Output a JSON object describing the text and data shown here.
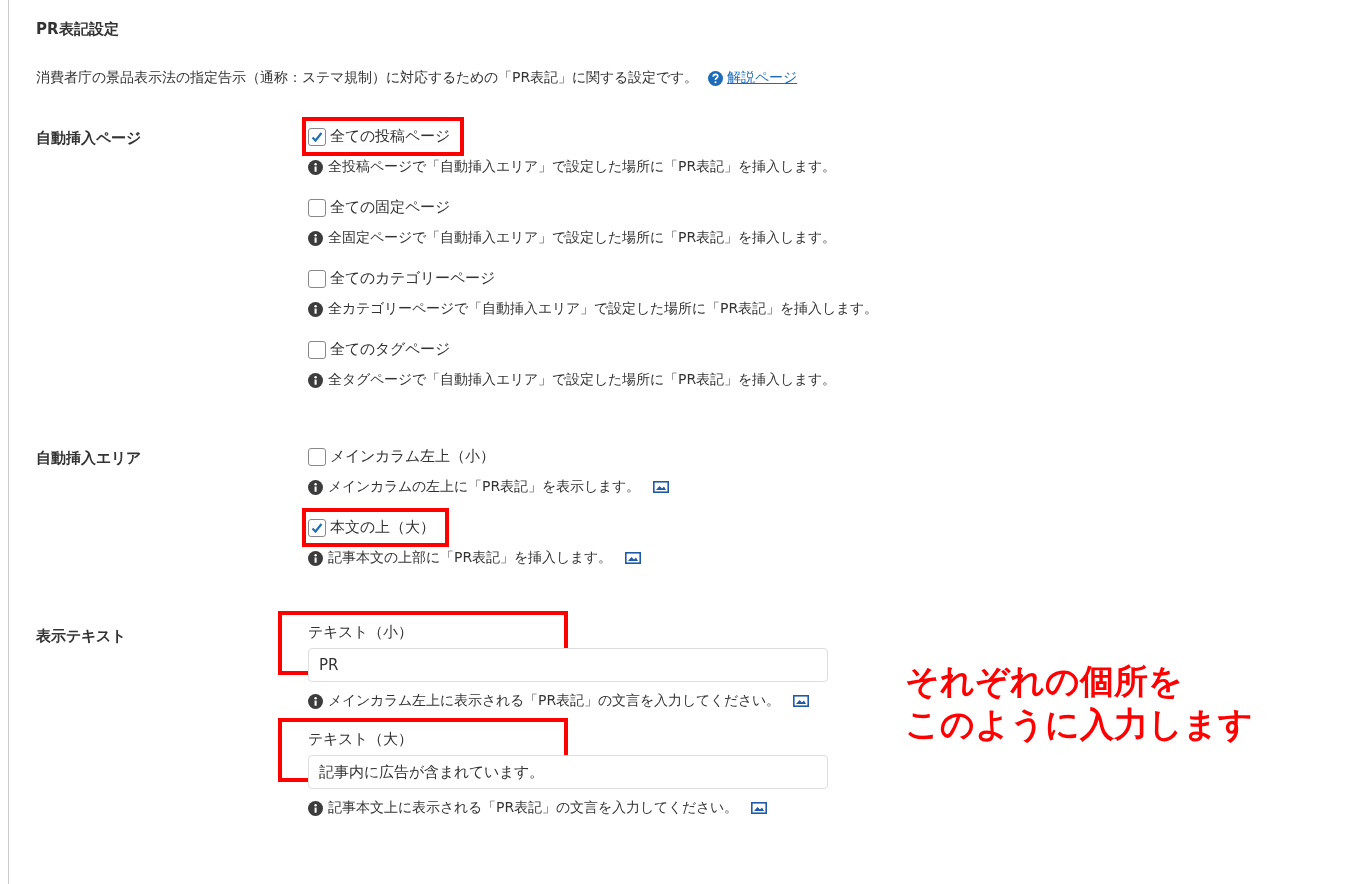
{
  "section_title": "PR表記設定",
  "description": {
    "text": "消費者庁の景品表示法の指定告示（通称：ステマ規制）に対応するための「PR表記」に関する設定です。",
    "link": "解説ページ"
  },
  "rows": [
    {
      "label": "自動挿入ページ",
      "kind": "checkboxes",
      "items": [
        {
          "label": "全ての投稿ページ",
          "checked": true,
          "highlighted": true,
          "help": "全投稿ページで「自動挿入エリア」で設定した場所に「PR表記」を挿入します。",
          "has_image_icon": false
        },
        {
          "label": "全ての固定ページ",
          "checked": false,
          "highlighted": false,
          "help": "全固定ページで「自動挿入エリア」で設定した場所に「PR表記」を挿入します。",
          "has_image_icon": false
        },
        {
          "label": "全てのカテゴリーページ",
          "checked": false,
          "highlighted": false,
          "help": "全カテゴリーページで「自動挿入エリア」で設定した場所に「PR表記」を挿入します。",
          "has_image_icon": false
        },
        {
          "label": "全てのタグページ",
          "checked": false,
          "highlighted": false,
          "help": "全タグページで「自動挿入エリア」で設定した場所に「PR表記」を挿入します。",
          "has_image_icon": false
        }
      ]
    },
    {
      "label": "自動挿入エリア",
      "kind": "checkboxes",
      "items": [
        {
          "label": "メインカラム左上（小）",
          "checked": false,
          "highlighted": false,
          "help": "メインカラムの左上に「PR表記」を表示します。",
          "has_image_icon": true
        },
        {
          "label": "本文の上（大）",
          "checked": true,
          "highlighted": true,
          "help": "記事本文の上部に「PR表記」を挿入します。",
          "has_image_icon": true
        }
      ]
    },
    {
      "label": "表示テキスト",
      "kind": "fields",
      "items": [
        {
          "label": "テキスト（小）",
          "value": "PR",
          "highlighted": true,
          "help": "メインカラム左上に表示される「PR表記」の文言を入力してください。",
          "has_image_icon": true
        },
        {
          "label": "テキスト（大）",
          "value": "記事内に広告が含まれています。",
          "highlighted": true,
          "help": "記事本文上に表示される「PR表記」の文言を入力してください。",
          "has_image_icon": true
        }
      ]
    }
  ],
  "annotation": [
    "それぞれの個所を",
    "このように入力します"
  ]
}
